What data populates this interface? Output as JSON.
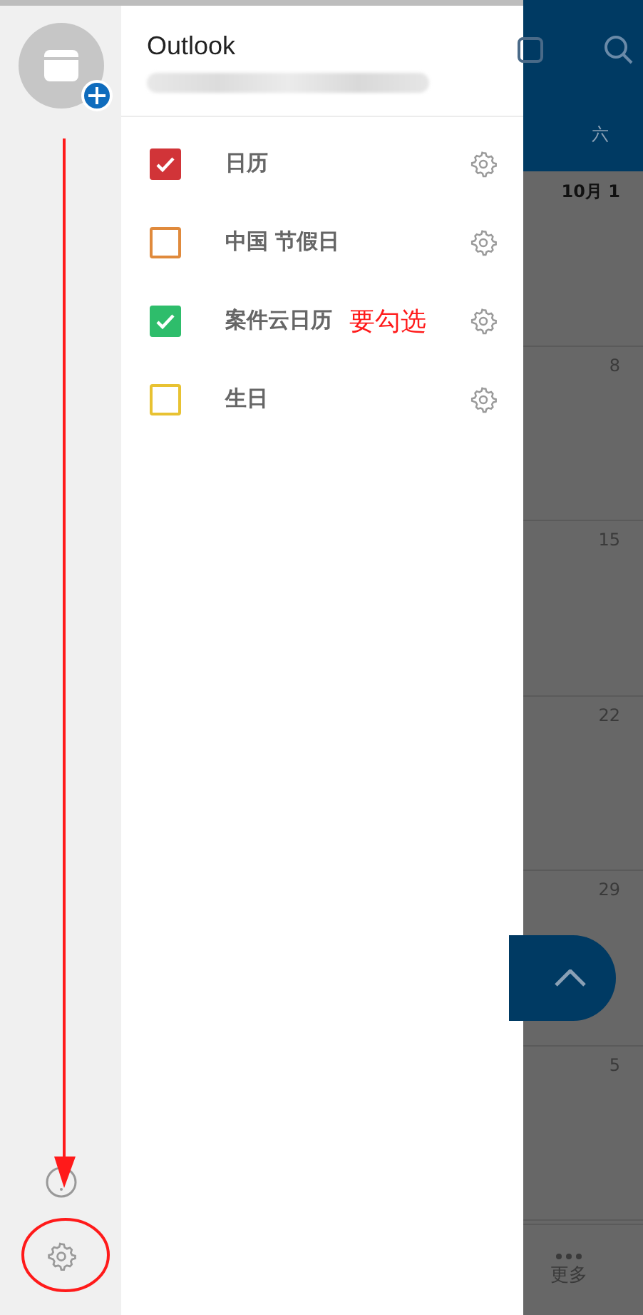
{
  "account": {
    "title": "Outlook"
  },
  "calendars": [
    {
      "name": "日历",
      "checked": true,
      "color": "#d13438"
    },
    {
      "name": "中国 节假日",
      "checked": false,
      "color": "#e08a3c"
    },
    {
      "name": "案件云日历",
      "checked": true,
      "color": "#2ebd6b",
      "note": "要勾选"
    },
    {
      "name": "生日",
      "checked": false,
      "color": "#e8c232"
    }
  ],
  "calendar_view": {
    "weekday": "六",
    "dates": [
      "10月 1",
      "8",
      "15",
      "22",
      "29",
      "5"
    ]
  },
  "bottom_nav": {
    "label": "更多"
  }
}
